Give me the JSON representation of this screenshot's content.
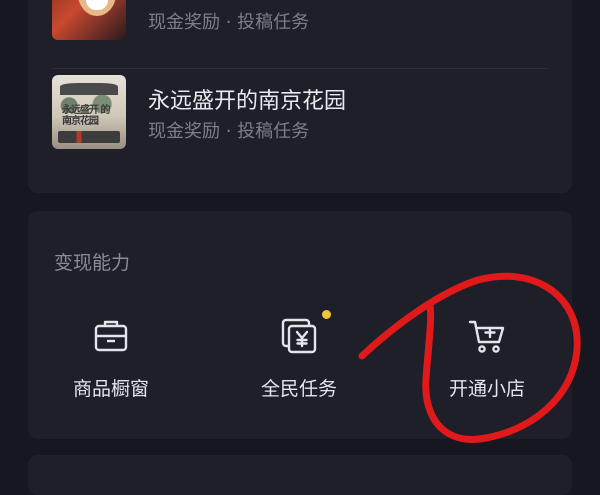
{
  "tasks": [
    {
      "title": "",
      "subtitle": "现金奖励 · 投稿任务",
      "thumbnail_icon": "anime-cover"
    },
    {
      "title": "永远盛开的南京花园",
      "subtitle": "现金奖励 · 投稿任务",
      "thumbnail_icon": "garden-cover",
      "thumbnail_text": "永远盛开 的南京花园"
    }
  ],
  "monetize": {
    "title": "变现能力",
    "items": [
      {
        "label": "商品橱窗",
        "icon": "showcase-icon"
      },
      {
        "label": "全民任务",
        "icon": "task-yuan-icon",
        "has_badge": true
      },
      {
        "label": "开通小店",
        "icon": "cart-plus-icon"
      }
    ]
  },
  "colors": {
    "background": "#17171f",
    "card": "#1f1f29",
    "badge": "#f2c43a",
    "annotation": "#e01a1a"
  }
}
